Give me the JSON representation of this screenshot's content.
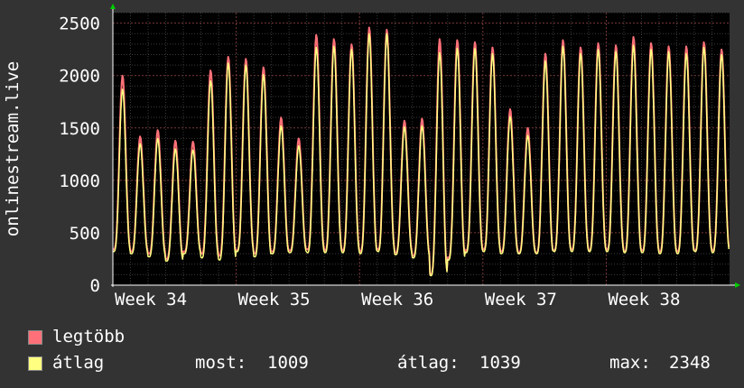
{
  "chart_data": {
    "type": "line",
    "ylabel": "onlinestream.live",
    "ylim": [
      0,
      2600
    ],
    "y_ticks": [
      "0",
      "500",
      "1000",
      "1500",
      "2000",
      "2500"
    ],
    "x_ticks": [
      "Week 34",
      "Week 35",
      "Week 36",
      "Week 37",
      "Week 38"
    ],
    "days": 35,
    "grid": true,
    "series": [
      {
        "name": "legtöbb",
        "color": "#ff7078",
        "daily_peaks": [
          2000,
          1420,
          1480,
          1380,
          1370,
          2050,
          2180,
          2160,
          2080,
          1600,
          1400,
          2390,
          2350,
          2300,
          2460,
          2440,
          1570,
          1590,
          2350,
          2340,
          2320,
          2270,
          1680,
          1500,
          2210,
          2340,
          2270,
          2310,
          2290,
          2370,
          2310,
          2280,
          2280,
          2320,
          2250
        ],
        "daily_mins": [
          340,
          320,
          300,
          250,
          320,
          300,
          280,
          330,
          300,
          320,
          330,
          340,
          330,
          330,
          320,
          340,
          310,
          280,
          100,
          260,
          330,
          340,
          320,
          310,
          310,
          330,
          340,
          330,
          340,
          320,
          330,
          320,
          320,
          330,
          330
        ]
      },
      {
        "name": "átlag",
        "color": "#ffff80",
        "daily_peaks": [
          1870,
          1350,
          1400,
          1300,
          1290,
          1950,
          2120,
          2100,
          2010,
          1520,
          1330,
          2270,
          2280,
          2250,
          2400,
          2400,
          1510,
          1520,
          2220,
          2260,
          2260,
          2210,
          1610,
          1430,
          2140,
          2280,
          2210,
          2250,
          2230,
          2290,
          2250,
          2230,
          2210,
          2270,
          2200
        ],
        "daily_mins": [
          320,
          300,
          270,
          230,
          300,
          260,
          240,
          320,
          270,
          300,
          310,
          310,
          310,
          310,
          300,
          320,
          290,
          260,
          90,
          240,
          310,
          320,
          300,
          300,
          300,
          320,
          320,
          320,
          320,
          310,
          310,
          300,
          300,
          320,
          310
        ]
      }
    ]
  },
  "legend": [
    {
      "label": "legtöbb",
      "color": "#ff7078"
    },
    {
      "label": "átlag",
      "color": "#ffff80"
    }
  ],
  "stats": {
    "most_label": "most:",
    "most_value": "1009",
    "atlag_label": "átlag:",
    "atlag_value": "1039",
    "max_label": "max:",
    "max_value": "2348"
  }
}
